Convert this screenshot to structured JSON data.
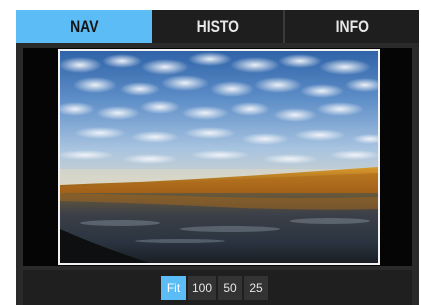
{
  "tabs": [
    {
      "label": "NAV",
      "active": true
    },
    {
      "label": "HISTO",
      "active": false
    },
    {
      "label": "INFO",
      "active": false
    }
  ],
  "zoom": {
    "options": [
      "Fit",
      "100",
      "50",
      "25"
    ],
    "selected": "Fit"
  },
  "colors": {
    "accent": "#5cbcf6",
    "panel_bg": "#2a2a2a",
    "viewer_bg": "#050505"
  }
}
